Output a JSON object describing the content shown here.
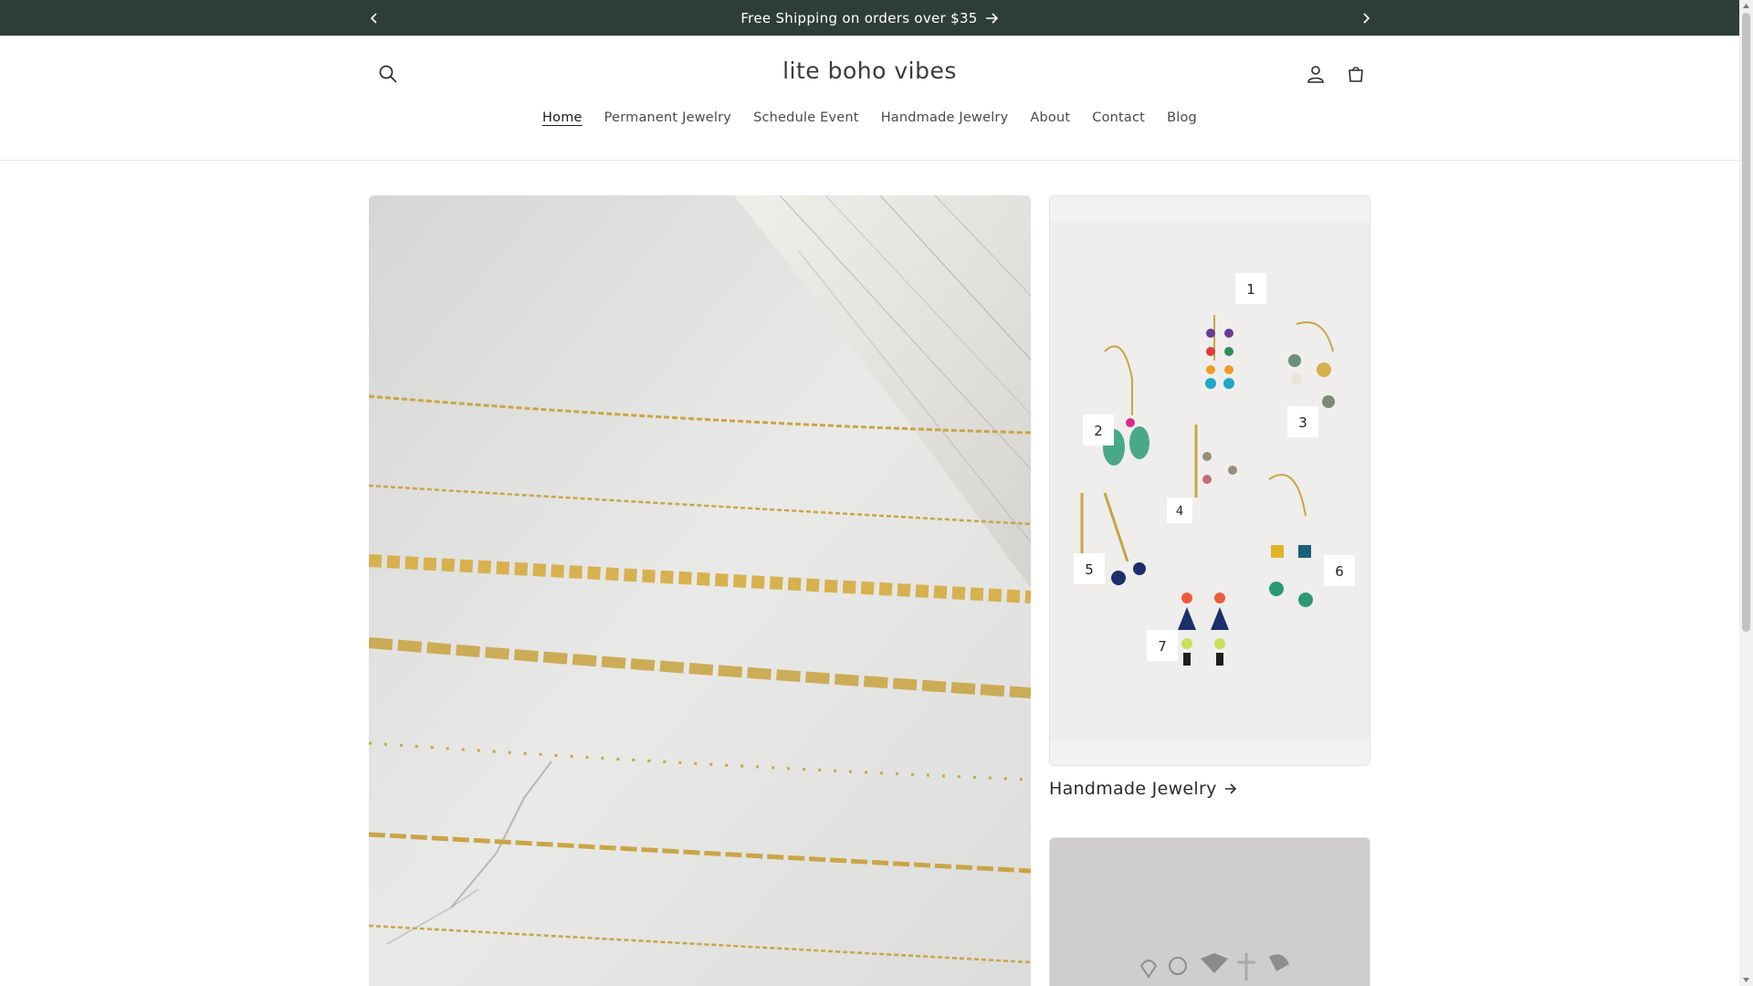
{
  "announcement": {
    "text": "Free Shipping on orders over $35",
    "prev_icon": "chevron-left-icon",
    "next_icon": "chevron-right-icon",
    "arrow_icon": "arrow-right-icon"
  },
  "header": {
    "logo": "lite boho vibes",
    "search_icon": "search-icon",
    "account_icon": "user-icon",
    "cart_icon": "cart-icon"
  },
  "nav": {
    "items": [
      "Home",
      "Permanent Jewelry",
      "Schedule Event",
      "Handmade Jewelry",
      "About",
      "Contact",
      "Blog"
    ],
    "active": "Home"
  },
  "hero": {
    "image": "gold-chains-image"
  },
  "collections": [
    {
      "title": "Handmade Jewelry",
      "image": "earrings-collage-image",
      "labels": [
        "1",
        "2",
        "3",
        "4",
        "5",
        "6",
        "7"
      ]
    },
    {
      "image": "silver-charms-image"
    }
  ],
  "colors": {
    "announcement_bg": "#2f3d37",
    "announcement_text": "#ffffff",
    "gold": "#c9a546"
  }
}
